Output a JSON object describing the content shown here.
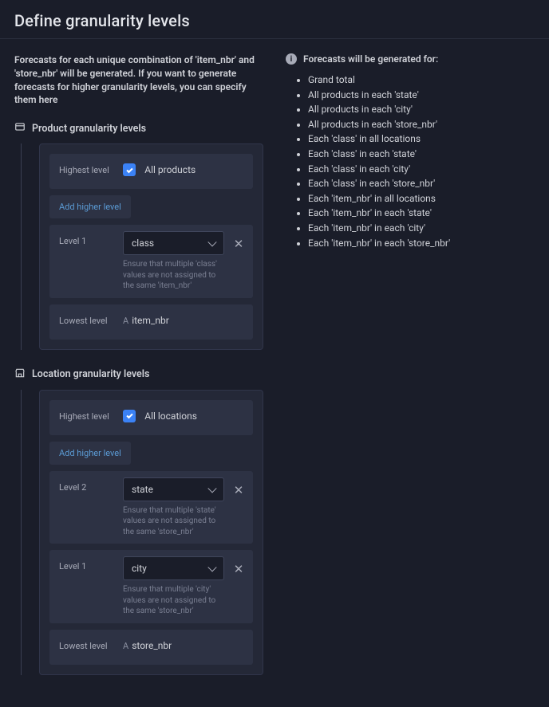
{
  "header": {
    "title": "Define granularity levels"
  },
  "intro": "Forecasts for each unique combination of 'item_nbr' and 'store_nbr' will be generated. If you want to generate forecasts for higher granularity levels, you can specify them here",
  "product": {
    "section_title": "Product granularity levels",
    "highest_label": "Highest level",
    "highest_check": "All products",
    "add_link": "Add higher level",
    "levels": [
      {
        "label": "Level 1",
        "value": "class",
        "helper": "Ensure that multiple 'class' values are not assigned to the same 'item_nbr'"
      }
    ],
    "lowest_label": "Lowest level",
    "lowest_prefix": "A",
    "lowest_value": "item_nbr"
  },
  "location": {
    "section_title": "Location granularity levels",
    "highest_label": "Highest level",
    "highest_check": "All locations",
    "add_link": "Add higher level",
    "levels": [
      {
        "label": "Level 2",
        "value": "state",
        "helper": "Ensure that multiple 'state' values are not assigned to the same 'store_nbr'"
      },
      {
        "label": "Level 1",
        "value": "city",
        "helper": "Ensure that multiple 'city' values are not assigned to the same 'store_nbr'"
      }
    ],
    "lowest_label": "Lowest level",
    "lowest_prefix": "A",
    "lowest_value": "store_nbr"
  },
  "forecasts": {
    "heading": "Forecasts will be generated for:",
    "items": [
      "Grand total",
      "All products in each 'state'",
      "All products in each 'city'",
      "All products in each 'store_nbr'",
      "Each 'class' in all locations",
      "Each 'class' in each 'state'",
      "Each 'class' in each 'city'",
      "Each 'class' in each 'store_nbr'",
      "Each 'item_nbr' in all locations",
      "Each 'item_nbr' in each 'state'",
      "Each 'item_nbr' in each 'city'",
      "Each 'item_nbr' in each 'store_nbr'"
    ]
  }
}
